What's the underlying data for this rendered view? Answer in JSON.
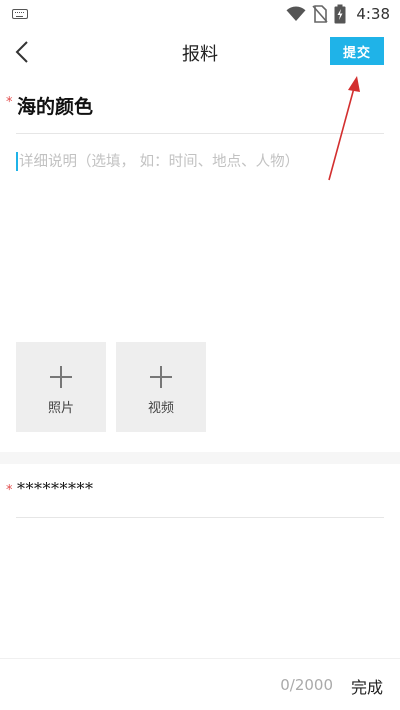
{
  "status_bar": {
    "time": "4:38",
    "icons": [
      "keyboard-icon",
      "wifi-icon",
      "no-sim-icon",
      "battery-charging-icon"
    ]
  },
  "header": {
    "title": "报料",
    "submit_label": "提交",
    "back_icon": "chevron-left-icon"
  },
  "form": {
    "required_mark": "*",
    "title_value": "海的颜色",
    "detail_placeholder": "详细说明（选填，  如：时间、地点、人物）",
    "media": [
      {
        "label": "照片",
        "icon": "plus-icon"
      },
      {
        "label": "视频",
        "icon": "plus-icon"
      }
    ],
    "masked_value": "*********"
  },
  "footer": {
    "char_count": "0/2000",
    "done_label": "完成"
  },
  "colors": {
    "accent": "#1fb3e8",
    "required": "#e24b4b",
    "annotation_arrow": "#d32f2f",
    "tile_bg": "#eeeeee"
  }
}
